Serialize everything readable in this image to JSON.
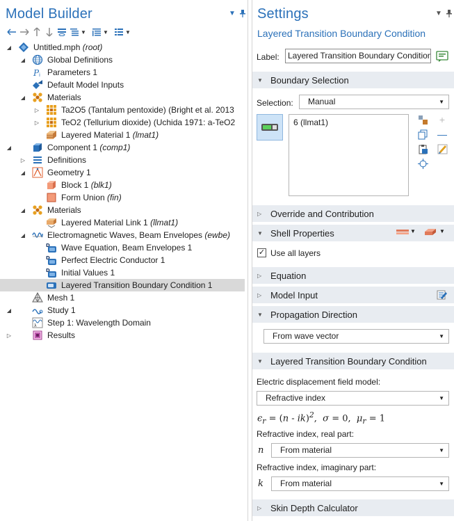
{
  "model_builder": {
    "title": "Model Builder",
    "tree": [
      {
        "id": "root",
        "label": "Untitled.mph",
        "tag": "(root)",
        "expanded": true,
        "icon": "mph-file-icon"
      },
      {
        "id": "global-defs",
        "label": "Global Definitions",
        "tag": "",
        "expanded": true,
        "icon": "globe-icon"
      },
      {
        "id": "parameters",
        "label": "Parameters 1",
        "tag": "",
        "icon": "parameters-icon"
      },
      {
        "id": "default-inputs",
        "label": "Default Model Inputs",
        "tag": "",
        "icon": "default-inputs-icon"
      },
      {
        "id": "global-materials",
        "label": "Materials",
        "tag": "",
        "expanded": true,
        "icon": "materials-icon"
      },
      {
        "id": "ta2o5",
        "label": "Ta2O5 (Tantalum pentoxide) (Bright et al. 2013",
        "tag": "",
        "expanded": false,
        "icon": "material-icon"
      },
      {
        "id": "teo2",
        "label": "TeO2 (Tellurium dioxide) (Uchida 1971: a-TeO2",
        "tag": "",
        "expanded": false,
        "icon": "material-icon"
      },
      {
        "id": "layered-material",
        "label": "Layered Material 1",
        "tag": "(lmat1)",
        "icon": "layered-material-icon"
      },
      {
        "id": "component",
        "label": "Component 1",
        "tag": "(comp1)",
        "expanded": true,
        "icon": "component-icon"
      },
      {
        "id": "definitions",
        "label": "Definitions",
        "tag": "",
        "expanded": false,
        "icon": "definitions-icon"
      },
      {
        "id": "geometry",
        "label": "Geometry 1",
        "tag": "",
        "expanded": true,
        "icon": "geometry-icon"
      },
      {
        "id": "block",
        "label": "Block 1",
        "tag": "(blk1)",
        "icon": "block-icon"
      },
      {
        "id": "form-union",
        "label": "Form Union",
        "tag": "(fin)",
        "icon": "form-union-icon"
      },
      {
        "id": "comp-materials",
        "label": "Materials",
        "tag": "",
        "expanded": true,
        "icon": "materials-icon"
      },
      {
        "id": "layered-link",
        "label": "Layered Material Link 1",
        "tag": "(llmat1)",
        "icon": "layered-link-icon"
      },
      {
        "id": "ewbe",
        "label": "Electromagnetic Waves, Beam Envelopes",
        "tag": "(ewbe)",
        "expanded": true,
        "icon": "physics-icon"
      },
      {
        "id": "wave-eq",
        "label": "Wave Equation, Beam Envelopes 1",
        "tag": "",
        "icon": "domain-feature-icon"
      },
      {
        "id": "pec",
        "label": "Perfect Electric Conductor 1",
        "tag": "",
        "icon": "domain-feature-icon"
      },
      {
        "id": "initial-values",
        "label": "Initial Values 1",
        "tag": "",
        "icon": "domain-feature-icon"
      },
      {
        "id": "ltbc",
        "label": "Layered Transition Boundary Condition 1",
        "tag": "",
        "icon": "boundary-feature-icon",
        "selected": true
      },
      {
        "id": "mesh",
        "label": "Mesh 1",
        "tag": "",
        "icon": "mesh-icon"
      },
      {
        "id": "study",
        "label": "Study 1",
        "tag": "",
        "expanded": true,
        "icon": "study-icon"
      },
      {
        "id": "step",
        "label": "Step 1: Wavelength Domain",
        "tag": "",
        "icon": "wavelength-step-icon"
      },
      {
        "id": "results",
        "label": "Results",
        "tag": "",
        "expanded": false,
        "icon": "results-icon"
      }
    ]
  },
  "settings": {
    "title": "Settings",
    "subtitle": "Layered Transition Boundary Condition",
    "label_caption": "Label:",
    "label_value": "Layered Transition Boundary Condition",
    "sections": {
      "boundary_selection": "Boundary Selection",
      "override": "Override and Contribution",
      "shell": "Shell Properties",
      "equation": "Equation",
      "model_input": "Model Input",
      "propagation": "Propagation Direction",
      "ltbc": "Layered Transition Boundary Condition",
      "skin_depth": "Skin Depth Calculator"
    },
    "selection_caption": "Selection:",
    "selection_value": "Manual",
    "selection_items": [
      "6 (llmat1)"
    ],
    "use_all_layers": "Use all layers",
    "propagation_value": "From wave vector",
    "edf_caption": "Electric displacement field model:",
    "edf_value": "Refractive index",
    "ri_real_caption": "Refractive index, real part:",
    "ri_real_symbol": "n",
    "ri_real_value": "From material",
    "ri_imag_caption": "Refractive index, imaginary part:",
    "ri_imag_symbol": "k",
    "ri_imag_value": "From material"
  },
  "colors": {
    "accent": "#2b71b9",
    "section_bg": "#e8ecf1",
    "selected_row": "#d9d9d9"
  }
}
